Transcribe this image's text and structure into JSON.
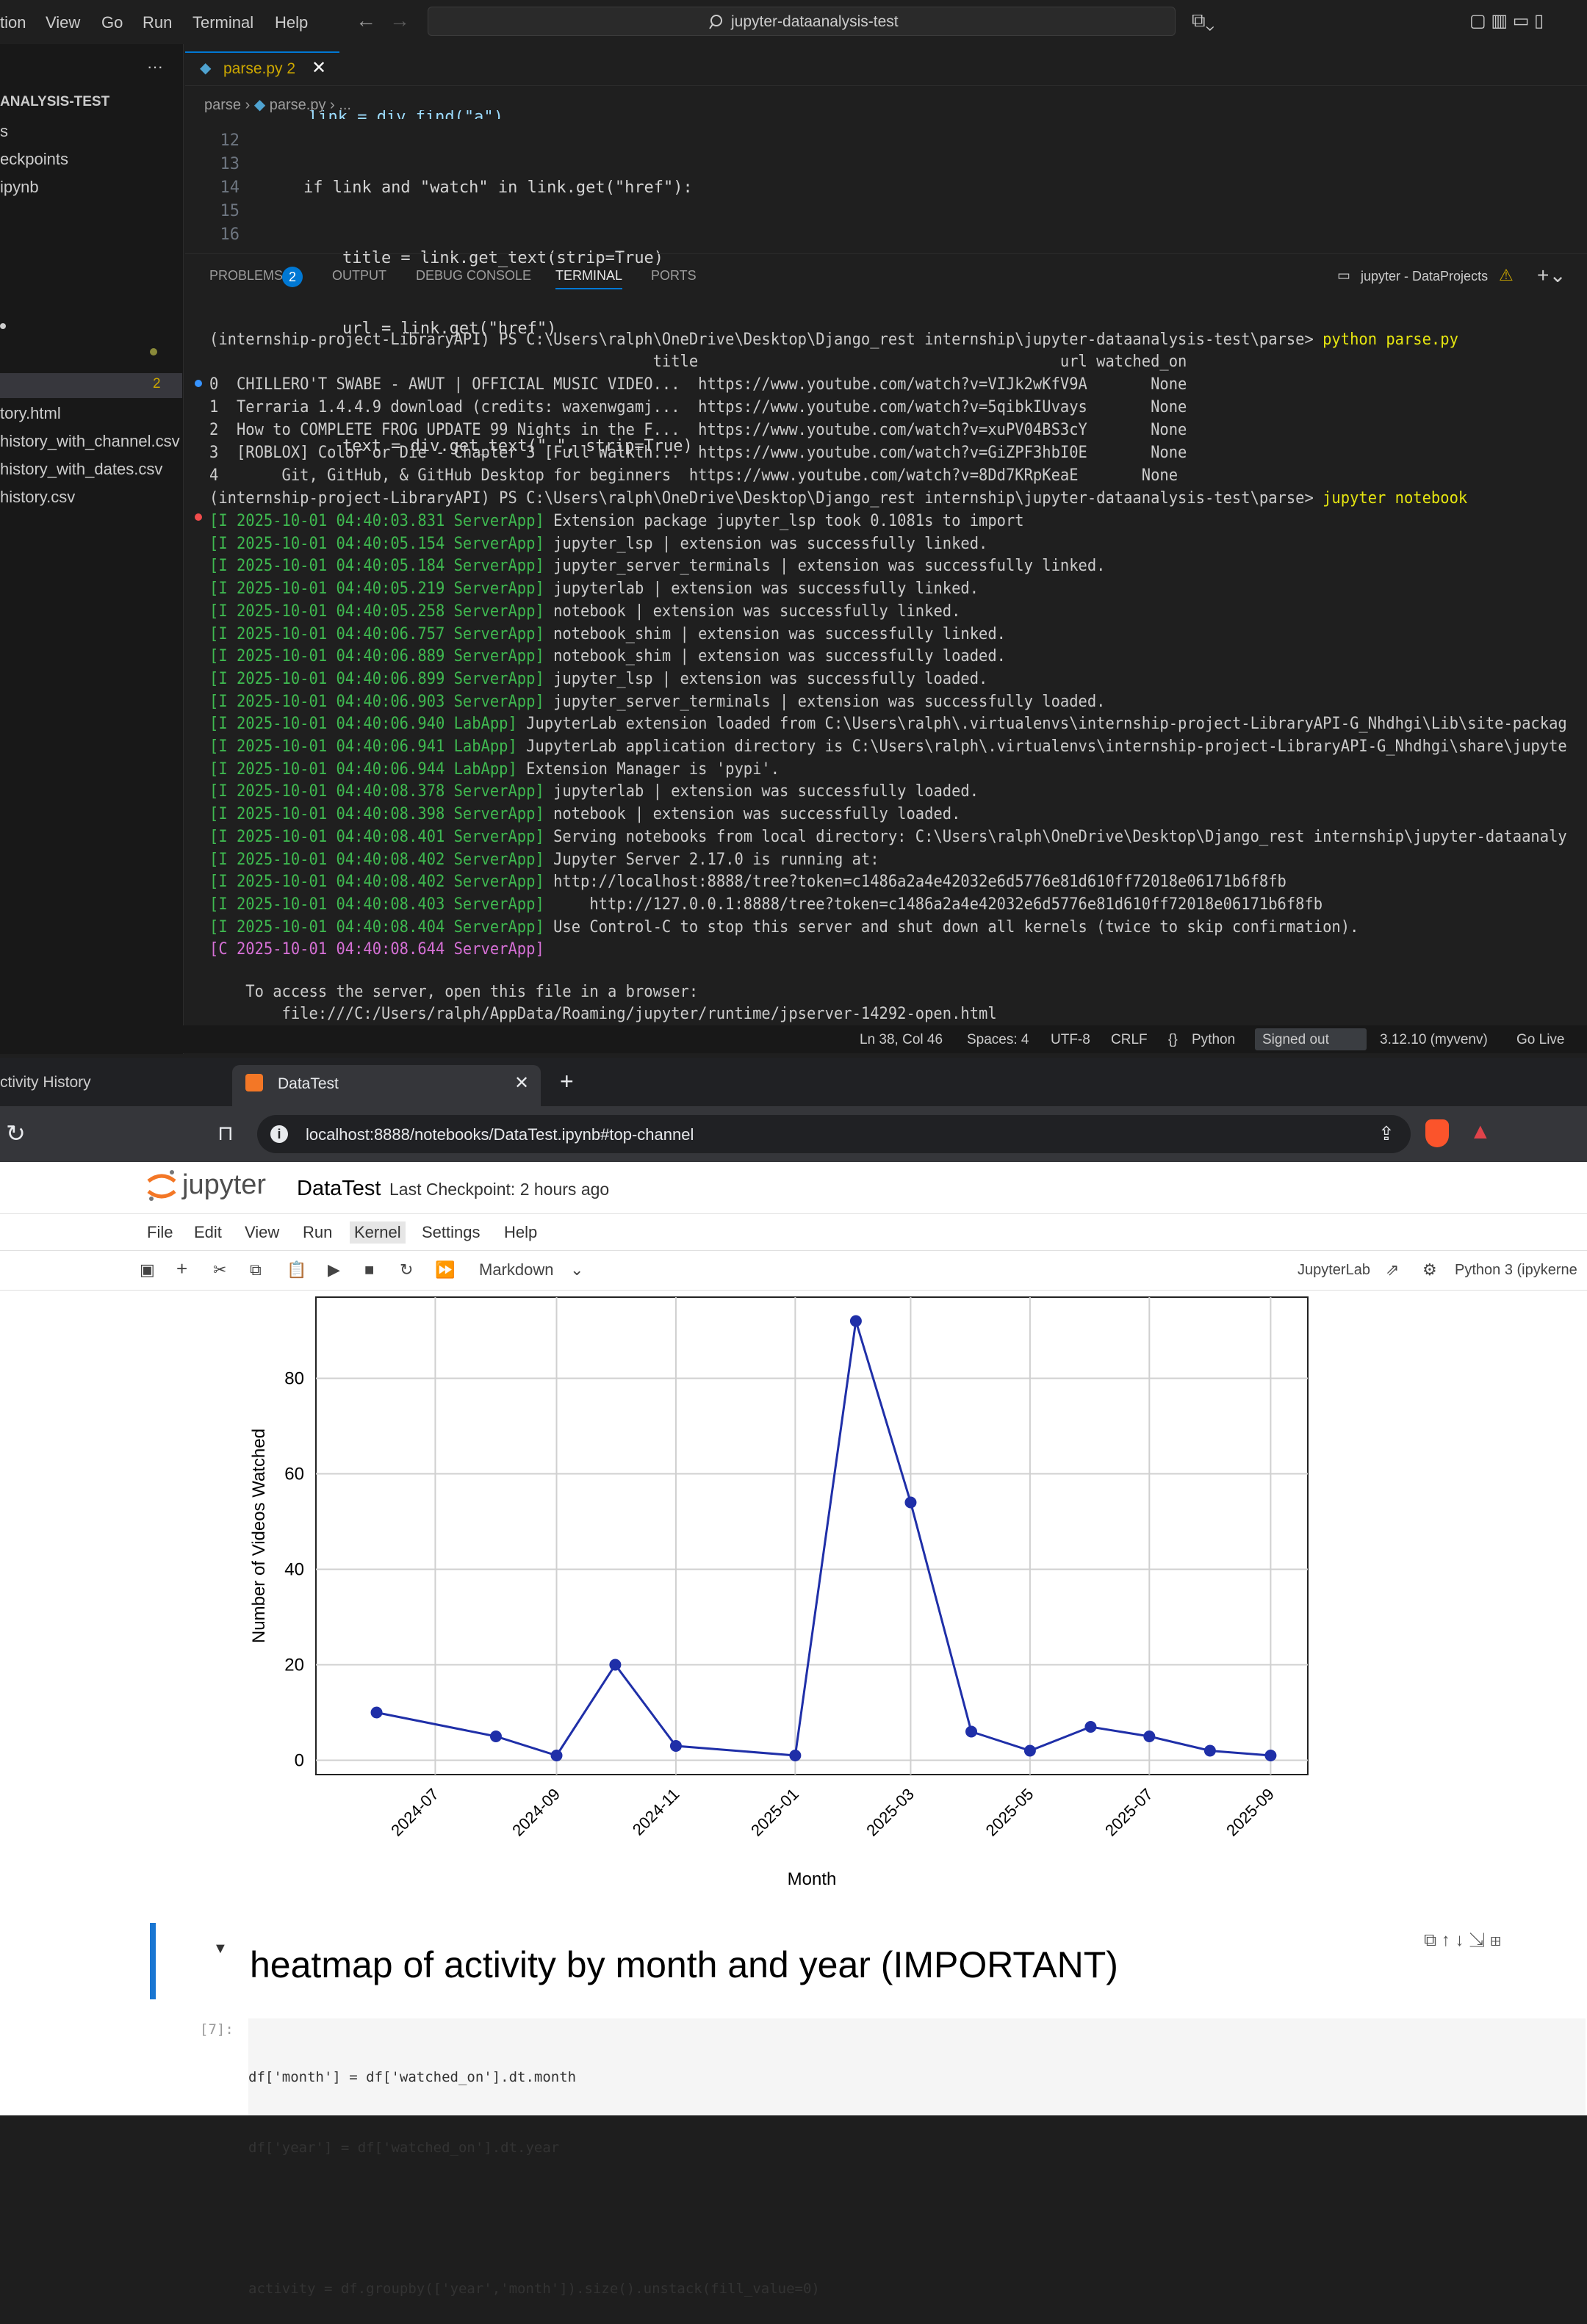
{
  "vscode": {
    "menu": [
      "tion",
      "View",
      "Go",
      "Run",
      "Terminal",
      "Help"
    ],
    "search": "jupyter-dataanalysis-test",
    "explorer": {
      "root": "ANALYSIS-TEST",
      "items": [
        "s",
        "eckpoints",
        "ipynb",
        "",
        "",
        "",
        "tory.html",
        "history_with_channel.csv",
        "history_with_dates.csv",
        "history.csv"
      ],
      "badge": "2"
    },
    "editor": {
      "tab": "parse.py 2",
      "breadcrumb": [
        "parse",
        "parse.py",
        "..."
      ],
      "lines": [
        {
          "n": "12",
          "code": "    if link and \"watch\" in link.get(\"href\"):"
        },
        {
          "n": "13",
          "code": "        title = link.get_text(strip=True)"
        },
        {
          "n": "14",
          "code": "        url = link.get(\"href\")"
        },
        {
          "n": "15",
          "code": ""
        },
        {
          "n": "16",
          "code": "        text = div.get_text(\" \", strip=True)"
        }
      ],
      "partial_line": "link = div.find(\"a\")"
    },
    "panel_tabs": [
      "PROBLEMS",
      "OUTPUT",
      "DEBUG CONSOLE",
      "TERMINAL",
      "PORTS"
    ],
    "problems_count": "2",
    "terminal_name": "jupyter - DataProjects",
    "terminal": {
      "prompt1": "(internship-project-LibraryAPI) PS C:\\Users\\ralph\\OneDrive\\Desktop\\Django_rest internship\\jupyter-dataanalysis-test\\parse> ",
      "cmd1": "python parse.py",
      "header": "                                                 title                                        url watched_on",
      "rows": [
        "0  CHILLERO'T SWABE - AWUT | OFFICIAL MUSIC VIDEO...  https://www.youtube.com/watch?v=VIJk2wKfV9A       None",
        "1  Terraria 1.4.4.9 download (credits: waxenwgamj...  https://www.youtube.com/watch?v=5qibkIUvays       None",
        "2  How to COMPLETE FROG UPDATE 99 Nights in the F...  https://www.youtube.com/watch?v=xuPV04BS3cY       None",
        "3  [ROBLOX] Color or Die - Chapter 3 [Full Walkth...  https://www.youtube.com/watch?v=GiZPF3hbI0E       None",
        "4       Git, GitHub, & GitHub Desktop for beginners  https://www.youtube.com/watch?v=8Dd7KRpKeaE       None"
      ],
      "prompt2": "(internship-project-LibraryAPI) PS C:\\Users\\ralph\\OneDrive\\Desktop\\Django_rest internship\\jupyter-dataanalysis-test\\parse> ",
      "cmd2": "jupyter notebook",
      "logs": [
        {
          "p": "[I 2025-10-01 04:40:03.831 ServerApp]",
          "m": " Extension package jupyter_lsp took 0.1081s to import"
        },
        {
          "p": "[I 2025-10-01 04:40:05.154 ServerApp]",
          "m": " jupyter_lsp | extension was successfully linked."
        },
        {
          "p": "[I 2025-10-01 04:40:05.184 ServerApp]",
          "m": " jupyter_server_terminals | extension was successfully linked."
        },
        {
          "p": "[I 2025-10-01 04:40:05.219 ServerApp]",
          "m": " jupyterlab | extension was successfully linked."
        },
        {
          "p": "[I 2025-10-01 04:40:05.258 ServerApp]",
          "m": " notebook | extension was successfully linked."
        },
        {
          "p": "[I 2025-10-01 04:40:06.757 ServerApp]",
          "m": " notebook_shim | extension was successfully linked."
        },
        {
          "p": "[I 2025-10-01 04:40:06.889 ServerApp]",
          "m": " notebook_shim | extension was successfully loaded."
        },
        {
          "p": "[I 2025-10-01 04:40:06.899 ServerApp]",
          "m": " jupyter_lsp | extension was successfully loaded."
        },
        {
          "p": "[I 2025-10-01 04:40:06.903 ServerApp]",
          "m": " jupyter_server_terminals | extension was successfully loaded."
        },
        {
          "p": "[I 2025-10-01 04:40:06.940 LabApp]",
          "m": " JupyterLab extension loaded from C:\\Users\\ralph\\.virtualenvs\\internship-project-LibraryAPI-G_Nhdhgi\\Lib\\site-packag"
        },
        {
          "p": "[I 2025-10-01 04:40:06.941 LabApp]",
          "m": " JupyterLab application directory is C:\\Users\\ralph\\.virtualenvs\\internship-project-LibraryAPI-G_Nhdhgi\\share\\jupyte"
        },
        {
          "p": "[I 2025-10-01 04:40:06.944 LabApp]",
          "m": " Extension Manager is 'pypi'."
        },
        {
          "p": "[I 2025-10-01 04:40:08.378 ServerApp]",
          "m": " jupyterlab | extension was successfully loaded."
        },
        {
          "p": "[I 2025-10-01 04:40:08.398 ServerApp]",
          "m": " notebook | extension was successfully loaded."
        },
        {
          "p": "[I 2025-10-01 04:40:08.401 ServerApp]",
          "m": " Serving notebooks from local directory: C:\\Users\\ralph\\OneDrive\\Desktop\\Django_rest internship\\jupyter-dataanaly"
        },
        {
          "p": "[I 2025-10-01 04:40:08.402 ServerApp]",
          "m": " Jupyter Server 2.17.0 is running at:"
        },
        {
          "p": "[I 2025-10-01 04:40:08.402 ServerApp]",
          "m": " http://localhost:8888/tree?token=c1486a2a4e42032e6d5776e81d610ff72018e06171b6f8fb"
        },
        {
          "p": "[I 2025-10-01 04:40:08.403 ServerApp]",
          "m": "     http://127.0.0.1:8888/tree?token=c1486a2a4e42032e6d5776e81d610ff72018e06171b6f8fb"
        },
        {
          "p": "[I 2025-10-01 04:40:08.404 ServerApp]",
          "m": " Use Control-C to stop this server and shut down all kernels (twice to skip confirmation)."
        },
        {
          "p": "[C 2025-10-01 04:40:08.644 ServerApp]",
          "m": ""
        }
      ],
      "access1": "    To access the server, open this file in a browser:",
      "access2": "        file:///C:/Users/ralph/AppData/Roaming/jupyter/runtime/jpserver-14292-open.html"
    },
    "status": [
      "Ln 38, Col 46",
      "Spaces: 4",
      "UTF-8",
      "CRLF",
      "Python",
      "Signed out",
      "3.12.10 (myvenv)",
      "Go Live"
    ]
  },
  "browser": {
    "tabs": [
      "ctivity History",
      "DataTest"
    ],
    "url": "localhost:8888/notebooks/DataTest.ipynb#top-channel"
  },
  "jupyter": {
    "logo": "jupyter",
    "notebook": "DataTest",
    "checkpoint": "Last Checkpoint: 2 hours ago",
    "menu": [
      "File",
      "Edit",
      "View",
      "Run",
      "Kernel",
      "Settings",
      "Help"
    ],
    "cell_type": "Markdown",
    "jupyterlab": "JupyterLab",
    "kernel": "Python 3 (ipykerne",
    "heading": "heatmap of activity by month and year (IMPORTANT)",
    "cell_prompt": "[7]:",
    "code": [
      "df['month'] = df['watched_on'].dt.month",
      "df['year'] = df['watched_on'].dt.year",
      "",
      "activity = df.groupby(['year','month']).size().unstack(fill_value=0)"
    ]
  },
  "chart_data": {
    "type": "line",
    "x": [
      "2024-06",
      "2024-08",
      "2024-09",
      "2024-10",
      "2024-11",
      "2025-01",
      "2025-02",
      "2025-03",
      "2025-04",
      "2025-05",
      "2025-06",
      "2025-07",
      "2025-08",
      "2025-09"
    ],
    "values": [
      10,
      5,
      1,
      20,
      3,
      1,
      92,
      54,
      6,
      2,
      7,
      5,
      2,
      1
    ],
    "xticks": [
      "2024-07",
      "2024-09",
      "2024-11",
      "2025-01",
      "2025-03",
      "2025-05",
      "2025-07",
      "2025-09"
    ],
    "yticks": [
      "0",
      "20",
      "40",
      "60",
      "80"
    ],
    "xlabel": "Month",
    "ylabel": "Number of Videos Watched",
    "ylim": [
      -3,
      97
    ],
    "grid": true,
    "color": "#1f2fa8"
  }
}
